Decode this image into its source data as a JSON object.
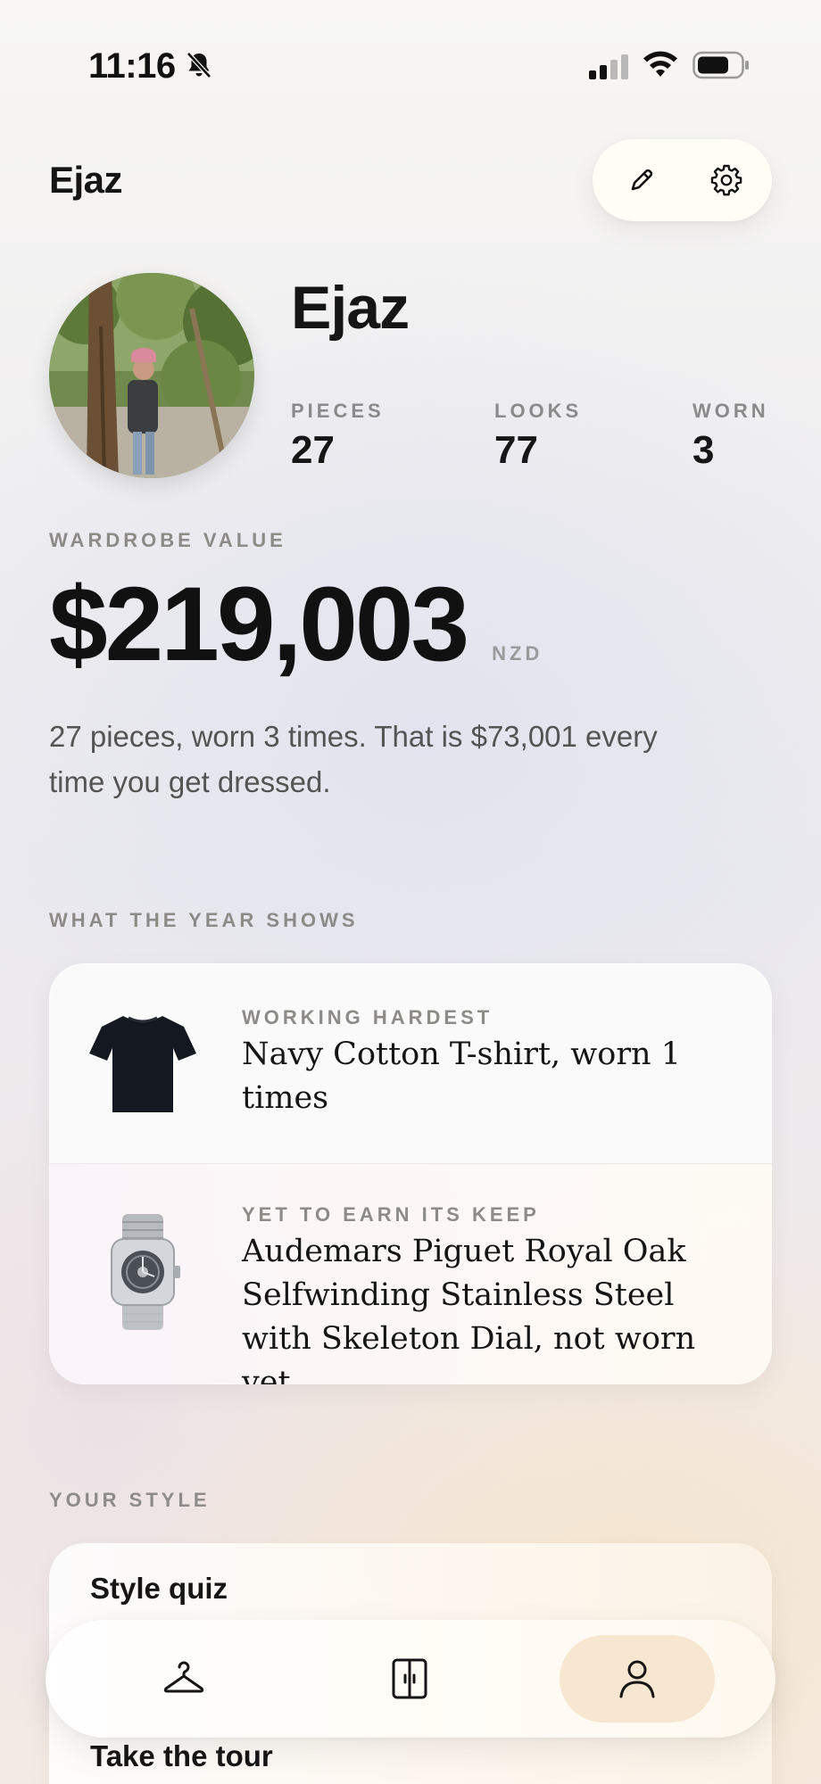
{
  "status_bar": {
    "time": "11:16"
  },
  "header": {
    "title": "Ejaz"
  },
  "profile": {
    "name": "Ejaz",
    "stats": [
      {
        "label": "PIECES",
        "value": "27"
      },
      {
        "label": "LOOKS",
        "value": "77"
      },
      {
        "label": "WORN",
        "value": "3"
      }
    ]
  },
  "wardrobe_value": {
    "label": "WARDROBE VALUE",
    "amount": "$219,003",
    "currency": "NZD",
    "description": "27 pieces, worn 3 times. That is $73,001 every time you get dressed."
  },
  "year": {
    "label": "WHAT THE YEAR SHOWS",
    "items": [
      {
        "eyebrow": "WORKING HARDEST",
        "text": "Navy Cotton T-shirt, worn 1 times",
        "icon": "tshirt-icon"
      },
      {
        "eyebrow": "YET TO EARN ITS KEEP",
        "text": "Audemars Piguet Royal Oak Selfwinding Stainless Steel with Skeleton Dial, not worn yet",
        "icon": "watch-icon"
      }
    ]
  },
  "style": {
    "label": "YOUR STYLE",
    "items": [
      "Style quiz",
      "Take the tour"
    ]
  },
  "nav": {
    "items": [
      {
        "name": "wardrobe",
        "icon": "hanger-icon"
      },
      {
        "name": "looks",
        "icon": "wardrobe-icon"
      },
      {
        "name": "profile",
        "icon": "person-icon",
        "active": true
      }
    ]
  },
  "colors": {
    "accent": "#f7e6d0",
    "text": "#151515",
    "muted": "#8d8b88"
  }
}
